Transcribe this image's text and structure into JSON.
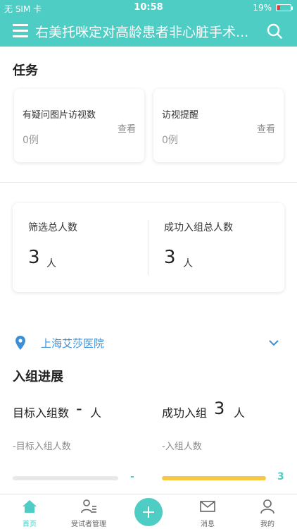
{
  "status_bar": {
    "carrier": "无 SIM 卡",
    "time": "10:58",
    "battery": "19%",
    "battery_level": 0.19
  },
  "header": {
    "title": "右美托咪定对高龄患者非心脏手术...",
    "menu_icon": "menu-icon",
    "search_icon": "search-icon"
  },
  "tasks": {
    "title": "任务",
    "items": [
      {
        "label": "有疑问图片访视数",
        "count": "0例",
        "view_label": "查看"
      },
      {
        "label": "访视提醒",
        "count": "0例",
        "view_label": "查看"
      }
    ]
  },
  "stats": {
    "screened_label": "筛选总人数",
    "screened_value": "3",
    "screened_unit": "人",
    "enrolled_label": "成功入组总人数",
    "enrolled_value": "3",
    "enrolled_unit": "人"
  },
  "hospital": {
    "name": "上海艾莎医院",
    "icon": "location-pin-icon"
  },
  "progress": {
    "title": "入组进展",
    "target_label": "目标入组数",
    "target_value": "-",
    "target_unit": "人",
    "target_sub": "-目标入组人数",
    "success_label": "成功入组",
    "success_value": "3",
    "success_unit": "人",
    "success_sub": "-入组人数",
    "target_bar_label": "-",
    "success_bar_label": "3",
    "target_fraction": 0,
    "success_fraction": 1,
    "colors": {
      "accent": "#4ecdc4",
      "bar_fill": "#f7c844",
      "bar_track": "#e8e8e8"
    }
  },
  "tabbar": {
    "tabs": [
      {
        "label": "首页",
        "icon": "home-icon",
        "active": true
      },
      {
        "label": "受试者管理",
        "icon": "subject-management-icon"
      },
      {
        "label": "消息",
        "icon": "mail-icon"
      },
      {
        "label": "我的",
        "icon": "profile-icon"
      }
    ],
    "fab_icon": "plus-icon"
  }
}
